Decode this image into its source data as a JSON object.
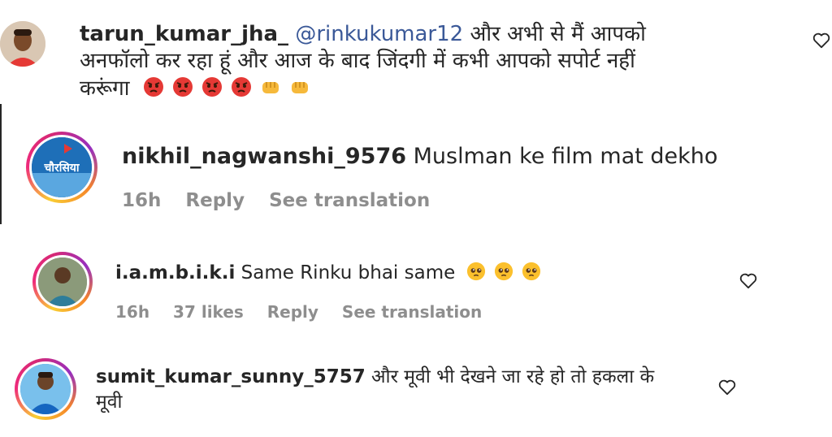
{
  "comments": [
    {
      "username": "tarun_kumar_jha_",
      "mention": "@rinkukumar12",
      "text_line1": "और अभी से मैं आपको",
      "text_line2": "अनफॉलो कर रहा हूं और आज के बाद जिंदगी में कभी आपको सपोर्ट नहीं",
      "text_line3": "करूंगा",
      "emojis": [
        "angry-face",
        "angry-face",
        "angry-face",
        "angry-face",
        "oncoming-fist",
        "oncoming-fist"
      ]
    },
    {
      "username": "nikhil_nagwanshi_9576",
      "text": "Muslman ke film mat dekho",
      "time": "16h",
      "reply_label": "Reply",
      "translate_label": "See translation",
      "avatar_text": "चौरसिया"
    },
    {
      "username": "i.a.m.b.i.k.i",
      "text": "Same Rinku bhai same",
      "emojis": [
        "pleading-face",
        "pleading-face",
        "pleading-face"
      ],
      "time": "16h",
      "likes": "37 likes",
      "reply_label": "Reply",
      "translate_label": "See translation"
    },
    {
      "username": "sumit_kumar_sunny_5757",
      "text_line1": "और मूवी भी देखने जा रहे हो तो हकला के",
      "text_line2": "मूवी"
    }
  ],
  "colors": {
    "text": "#262626",
    "meta": "#8e8e8e",
    "mention": "#3b5998"
  }
}
